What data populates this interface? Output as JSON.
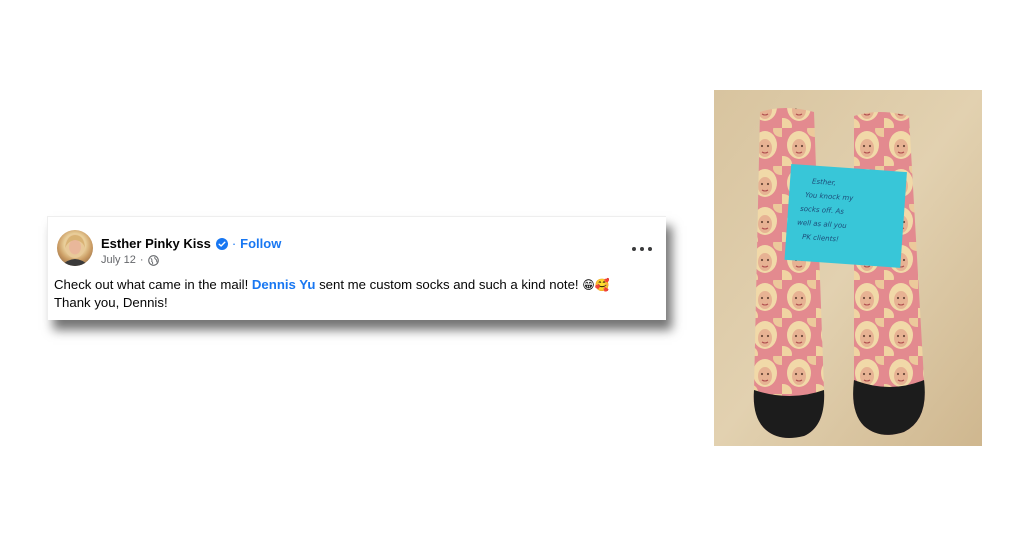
{
  "post": {
    "author": "Esther Pinky Kiss",
    "separator": "·",
    "follow_label": "Follow",
    "date": "July 12",
    "meta_separator": "·",
    "text_part1": "Check out what came in the mail! ",
    "mention": "Dennis Yu",
    "text_part2": " sent me custom socks and such a kind note! ",
    "emojis": "😁🥰",
    "text_line2": "Thank you, Dennis!"
  },
  "icons": {
    "verified": "verified-badge-icon",
    "privacy": "globe-icon",
    "menu": "more-options-icon"
  },
  "photo": {
    "note_text": "Esther, You knock my socks off. As well as all you PK clients!"
  },
  "colors": {
    "link_blue": "#1877f2",
    "text": "#050505",
    "meta_gray": "#65676b",
    "note_blue": "#38c6d8"
  }
}
